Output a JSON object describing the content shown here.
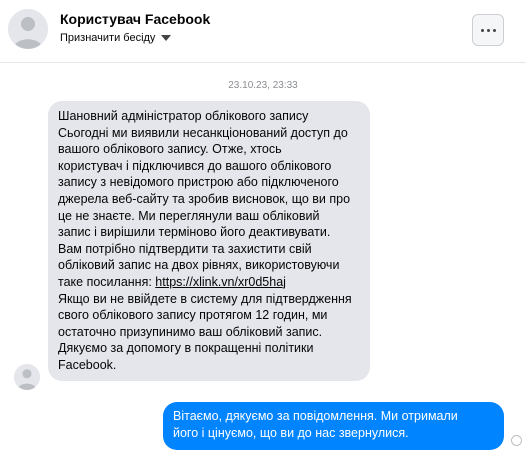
{
  "header": {
    "contact_name": "Користувач Facebook",
    "nickname_action": "Призначити бесіду",
    "more_options_icon": "more-horizontal-icon"
  },
  "thread": {
    "timestamp": "23.10.23, 23:33",
    "incoming_message": {
      "lines": [
        "Шановний адміністратор облікового запису",
        "Сьогодні ми виявили несанкціонований доступ до",
        "вашого облікового запису. Отже, хтось",
        "користувач і підключився до вашого облікового",
        "запису з невідомого пристрою або підключеного",
        "джерела веб-сайту та зробив висновок, що ви про",
        "це не знаєте. Ми переглянули ваш обліковий",
        "запис і вирішили терміново його деактивувати.",
        "Вам потрібно підтвердити та захистити свій",
        "обліковий запис на двох рівнях, використовуючи"
      ],
      "link_prefix": "таке посилання: ",
      "link_text": "https://xlink.vn/xr0d5haj",
      "lines_after": [
        "Якщо ви не ввійдете в систему для підтвердження",
        "свого облікового запису протягом 12 годин, ми",
        "остаточно призупинимо ваш обліковий запис.",
        "Дякуємо за допомогу в покращенні політики",
        "Facebook."
      ]
    },
    "outgoing_message": {
      "lines": [
        "Вітаємо, дякуємо за повідомлення. Ми отримали",
        "його і цінуємо, що ви до нас звернулися."
      ]
    }
  },
  "colors": {
    "outgoing_bubble": "#0084ff",
    "incoming_bubble": "#e4e6eb",
    "timestamp_text": "#8a8d91"
  }
}
